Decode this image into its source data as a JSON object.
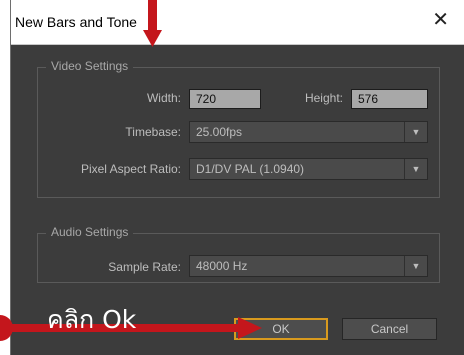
{
  "dialog": {
    "title": "New Bars and Tone"
  },
  "icons": {
    "close": "close-icon",
    "dropdown": "chevron-down-icon"
  },
  "video_settings": {
    "legend": "Video Settings",
    "width_label": "Width:",
    "width_value": "720",
    "height_label": "Height:",
    "height_value": "576",
    "timebase_label": "Timebase:",
    "timebase_value": "25.00fps",
    "par_label": "Pixel Aspect Ratio:",
    "par_value": "D1/DV PAL (1.0940)"
  },
  "audio_settings": {
    "legend": "Audio Settings",
    "sample_rate_label": "Sample Rate:",
    "sample_rate_value": "48000 Hz"
  },
  "buttons": {
    "ok": "OK",
    "cancel": "Cancel"
  },
  "annotation": {
    "text": "คลิก Ok",
    "color": "#c4161c"
  },
  "colors": {
    "accent": "#d89a1e",
    "dialog_bg": "#3c3c3c"
  }
}
